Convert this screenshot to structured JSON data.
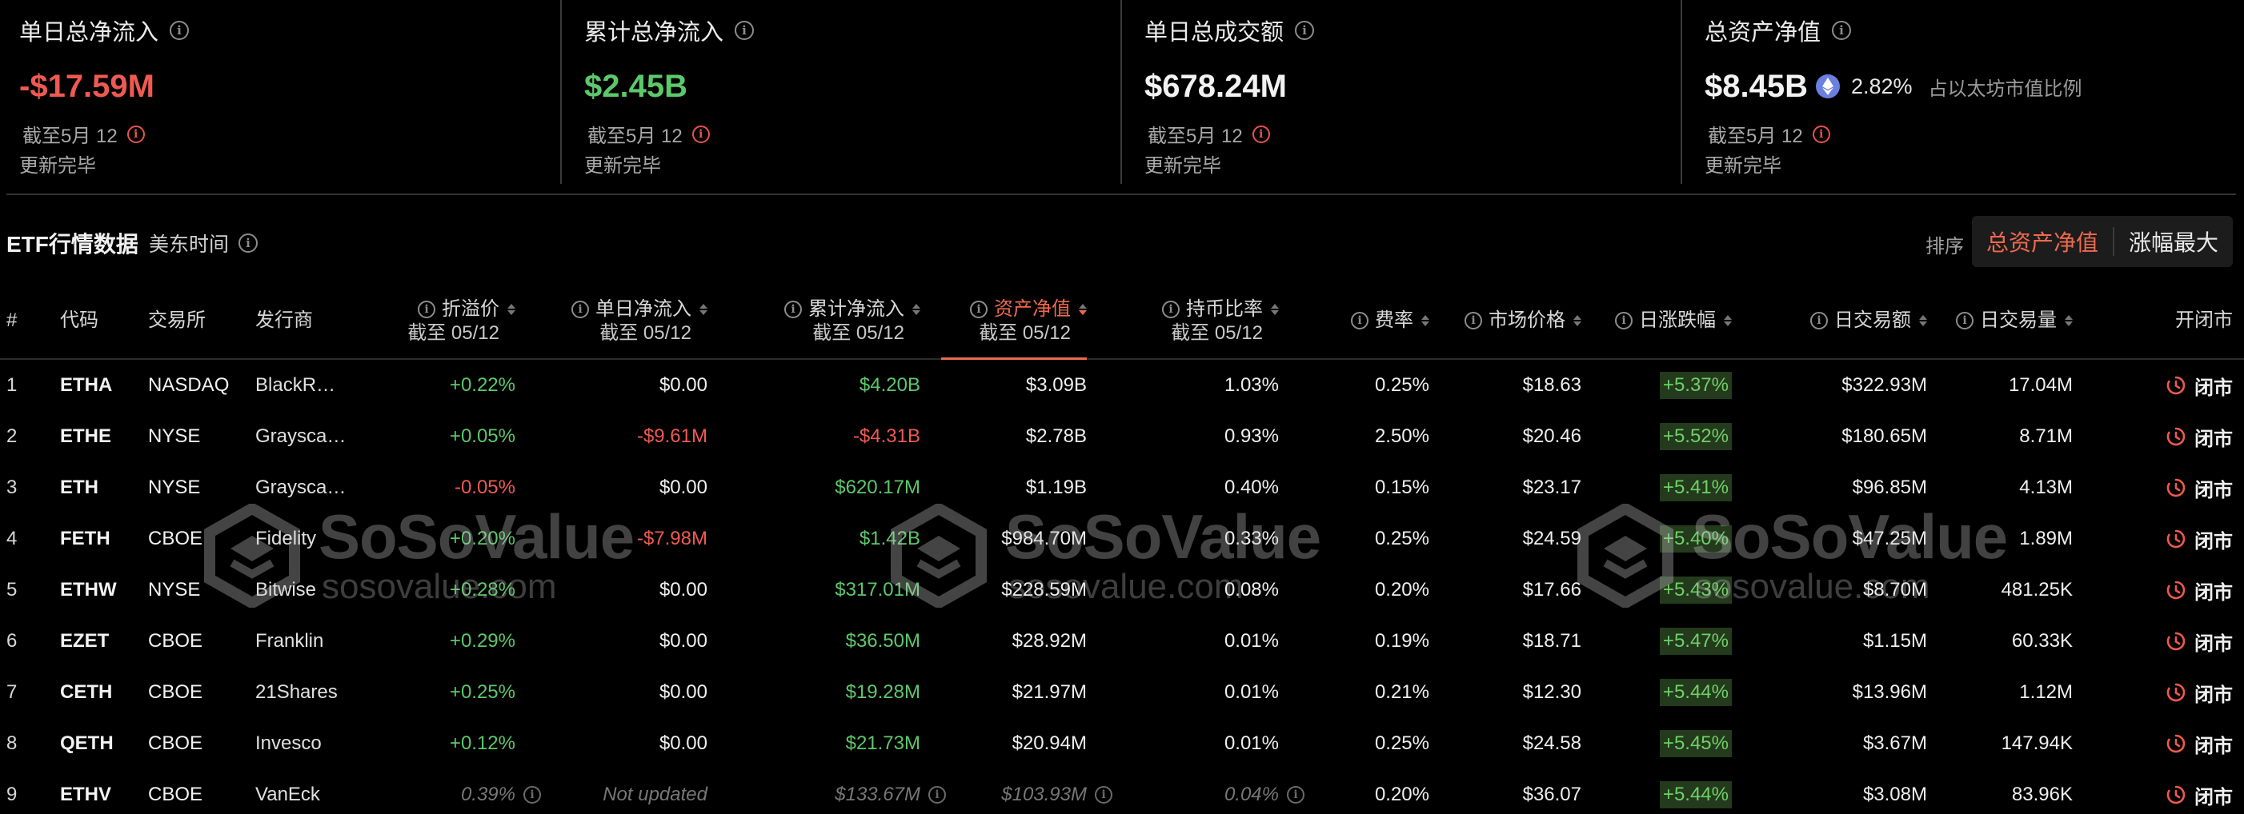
{
  "cards": [
    {
      "title": "单日总净流入",
      "value": "-$17.59M",
      "tone": "neg",
      "date": "截至5月 12",
      "status": "更新完毕"
    },
    {
      "title": "累计总净流入",
      "value": "$2.45B",
      "tone": "pos",
      "date": "截至5月 12",
      "status": "更新完毕"
    },
    {
      "title": "单日总成交额",
      "value": "$678.24M",
      "tone": "neutral",
      "date": "截至5月 12",
      "status": "更新完毕"
    },
    {
      "title": "总资产净值",
      "value": "$8.45B",
      "tone": "neutral",
      "pct": "2.82%",
      "share_label": "占以太坊市值比例",
      "date": "截至5月 12",
      "status": "更新完毕"
    }
  ],
  "section": {
    "title": "ETF行情数据",
    "timezone": "美东时间"
  },
  "sort": {
    "label": "排序",
    "options": [
      "总资产净值",
      "涨幅最大"
    ],
    "active": "总资产净值"
  },
  "table": {
    "headers": {
      "idx": "#",
      "code": "代码",
      "exchange": "交易所",
      "issuer": "发行商",
      "premium": "折溢价",
      "premium_sub": "截至 05/12",
      "daily_inflow": "单日净流入",
      "daily_inflow_sub": "截至 05/12",
      "cum_inflow": "累计净流入",
      "cum_inflow_sub": "截至 05/12",
      "nav": "资产净值",
      "nav_sub": "截至 05/12",
      "holding": "持币比率",
      "holding_sub": "截至 05/12",
      "fee": "费率",
      "price": "市场价格",
      "change": "日涨跌幅",
      "turnover": "日交易额",
      "volume": "日交易量",
      "status": "开闭市"
    },
    "rows": [
      {
        "idx": "1",
        "code": "ETHA",
        "exchange": "NASDAQ",
        "issuer": "BlackR…",
        "premium": "+0.22%",
        "premium_tone": "pos",
        "daily_inflow": "$0.00",
        "daily_inflow_tone": "plain",
        "cum_inflow": "$4.20B",
        "cum_inflow_tone": "pos",
        "nav": "$3.09B",
        "holding": "1.03%",
        "fee": "0.25%",
        "price": "$18.63",
        "change": "+5.37%",
        "turnover": "$322.93M",
        "volume": "17.04M",
        "status": "闭市",
        "stale": false
      },
      {
        "idx": "2",
        "code": "ETHE",
        "exchange": "NYSE",
        "issuer": "Graysca…",
        "premium": "+0.05%",
        "premium_tone": "pos",
        "daily_inflow": "-$9.61M",
        "daily_inflow_tone": "neg",
        "cum_inflow": "-$4.31B",
        "cum_inflow_tone": "neg",
        "nav": "$2.78B",
        "holding": "0.93%",
        "fee": "2.50%",
        "price": "$20.46",
        "change": "+5.52%",
        "turnover": "$180.65M",
        "volume": "8.71M",
        "status": "闭市",
        "stale": false
      },
      {
        "idx": "3",
        "code": "ETH",
        "exchange": "NYSE",
        "issuer": "Graysca…",
        "premium": "-0.05%",
        "premium_tone": "neg",
        "daily_inflow": "$0.00",
        "daily_inflow_tone": "plain",
        "cum_inflow": "$620.17M",
        "cum_inflow_tone": "pos",
        "nav": "$1.19B",
        "holding": "0.40%",
        "fee": "0.15%",
        "price": "$23.17",
        "change": "+5.41%",
        "turnover": "$96.85M",
        "volume": "4.13M",
        "status": "闭市",
        "stale": false
      },
      {
        "idx": "4",
        "code": "FETH",
        "exchange": "CBOE",
        "issuer": "Fidelity",
        "premium": "+0.20%",
        "premium_tone": "pos",
        "daily_inflow": "-$7.98M",
        "daily_inflow_tone": "neg",
        "cum_inflow": "$1.42B",
        "cum_inflow_tone": "pos",
        "nav": "$984.70M",
        "holding": "0.33%",
        "fee": "0.25%",
        "price": "$24.59",
        "change": "+5.40%",
        "turnover": "$47.25M",
        "volume": "1.89M",
        "status": "闭市",
        "stale": false
      },
      {
        "idx": "5",
        "code": "ETHW",
        "exchange": "NYSE",
        "issuer": "Bitwise",
        "premium": "+0.28%",
        "premium_tone": "pos",
        "daily_inflow": "$0.00",
        "daily_inflow_tone": "plain",
        "cum_inflow": "$317.01M",
        "cum_inflow_tone": "pos",
        "nav": "$228.59M",
        "holding": "0.08%",
        "fee": "0.20%",
        "price": "$17.66",
        "change": "+5.43%",
        "turnover": "$8.70M",
        "volume": "481.25K",
        "status": "闭市",
        "stale": false
      },
      {
        "idx": "6",
        "code": "EZET",
        "exchange": "CBOE",
        "issuer": "Franklin",
        "premium": "+0.29%",
        "premium_tone": "pos",
        "daily_inflow": "$0.00",
        "daily_inflow_tone": "plain",
        "cum_inflow": "$36.50M",
        "cum_inflow_tone": "pos",
        "nav": "$28.92M",
        "holding": "0.01%",
        "fee": "0.19%",
        "price": "$18.71",
        "change": "+5.47%",
        "turnover": "$1.15M",
        "volume": "60.33K",
        "status": "闭市",
        "stale": false
      },
      {
        "idx": "7",
        "code": "CETH",
        "exchange": "CBOE",
        "issuer": "21Shares",
        "premium": "+0.25%",
        "premium_tone": "pos",
        "daily_inflow": "$0.00",
        "daily_inflow_tone": "plain",
        "cum_inflow": "$19.28M",
        "cum_inflow_tone": "pos",
        "nav": "$21.97M",
        "holding": "0.01%",
        "fee": "0.21%",
        "price": "$12.30",
        "change": "+5.44%",
        "turnover": "$13.96M",
        "volume": "1.12M",
        "status": "闭市",
        "stale": false
      },
      {
        "idx": "8",
        "code": "QETH",
        "exchange": "CBOE",
        "issuer": "Invesco",
        "premium": "+0.12%",
        "premium_tone": "pos",
        "daily_inflow": "$0.00",
        "daily_inflow_tone": "plain",
        "cum_inflow": "$21.73M",
        "cum_inflow_tone": "pos",
        "nav": "$20.94M",
        "holding": "0.01%",
        "fee": "0.25%",
        "price": "$24.58",
        "change": "+5.45%",
        "turnover": "$3.67M",
        "volume": "147.94K",
        "status": "闭市",
        "stale": false
      },
      {
        "idx": "9",
        "code": "ETHV",
        "exchange": "CBOE",
        "issuer": "VanEck",
        "premium": "0.39%",
        "premium_tone": "muted",
        "daily_inflow": "Not updated",
        "daily_inflow_tone": "muted",
        "cum_inflow": "$133.67M",
        "cum_inflow_tone": "muted",
        "nav": "$103.93M",
        "holding": "0.04%",
        "fee": "0.20%",
        "price": "$36.07",
        "change": "+5.44%",
        "turnover": "$3.08M",
        "volume": "83.96K",
        "status": "闭市",
        "stale": true
      }
    ]
  },
  "watermark": {
    "brand": "SoSoValue",
    "url": "sosovalue.com"
  },
  "colors": {
    "positive": "#5cc86a",
    "negative": "#ee5a52",
    "accent": "#ee6a4e",
    "eth_badge": "#6b7fe0"
  },
  "icons": {
    "info": "info-icon",
    "eth": "ethereum-icon",
    "sort": "sort-caret-icon",
    "market_status": "clock-icon"
  }
}
